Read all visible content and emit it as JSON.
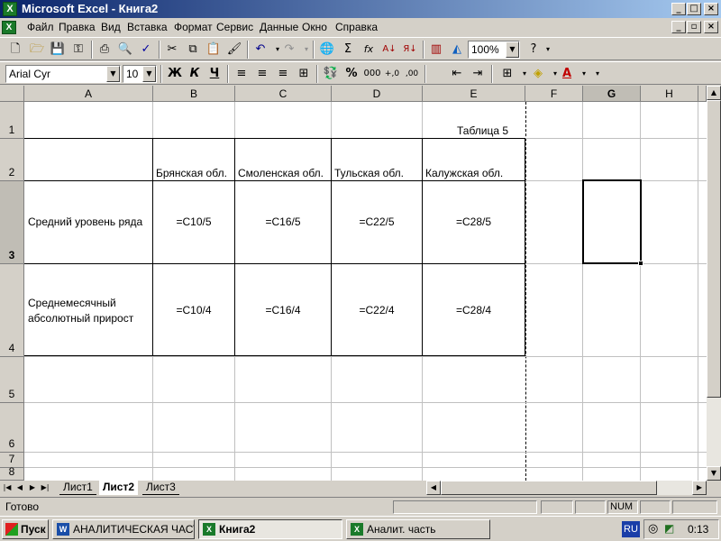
{
  "window": {
    "title": "Microsoft Excel - Книга2",
    "app_icon": "X"
  },
  "menubar": {
    "doc_icon": "X",
    "items": [
      "Файл",
      "Правка",
      "Вид",
      "Вставка",
      "Формат",
      "Сервис",
      "Данные",
      "Окно",
      "Справка"
    ]
  },
  "toolbar": {
    "zoom": "100%",
    "font_name": "Arial Cyr",
    "font_size": "10",
    "bold": "Ж",
    "italic": "К",
    "underline": "Ч",
    "percent": "%",
    "thousands": "000",
    "autosum": "Σ",
    "function": "fx"
  },
  "columns": [
    "A",
    "B",
    "C",
    "D",
    "E",
    "F",
    "G",
    "H"
  ],
  "rows": [
    "1",
    "2",
    "3",
    "4",
    "5",
    "6",
    "7",
    "8"
  ],
  "cells": {
    "E1": "Таблица 5",
    "B2": "Брянская обл.",
    "C2": "Смоленская обл.",
    "D2": "Тульская обл.",
    "E2": "Калужская обл.",
    "A3": "Средний уровень ряда",
    "B3": "=C10/5",
    "C3": "=C16/5",
    "D3": "=C22/5",
    "E3": "=C28/5",
    "A4_line1": "Среднемесячный",
    "A4_line2": "абсолютный прирост",
    "B4": "=C10/4",
    "C4": "=C16/4",
    "D4": "=C22/4",
    "E4": "=C28/4"
  },
  "active_cell": "G3",
  "sheets": [
    {
      "name": "Лист1",
      "active": false
    },
    {
      "name": "Лист2",
      "active": true
    },
    {
      "name": "Лист3",
      "active": false
    }
  ],
  "status": {
    "text": "Готово",
    "num": "NUM"
  },
  "taskbar": {
    "start": "Пуск",
    "tasks": [
      {
        "label": "АНАЛИТИЧЕСКАЯ ЧАСТ...",
        "active": false
      },
      {
        "label": "Книга2",
        "active": true
      },
      {
        "label": "Аналит. часть",
        "active": false
      }
    ],
    "lang": "RU",
    "clock": "0:13"
  }
}
